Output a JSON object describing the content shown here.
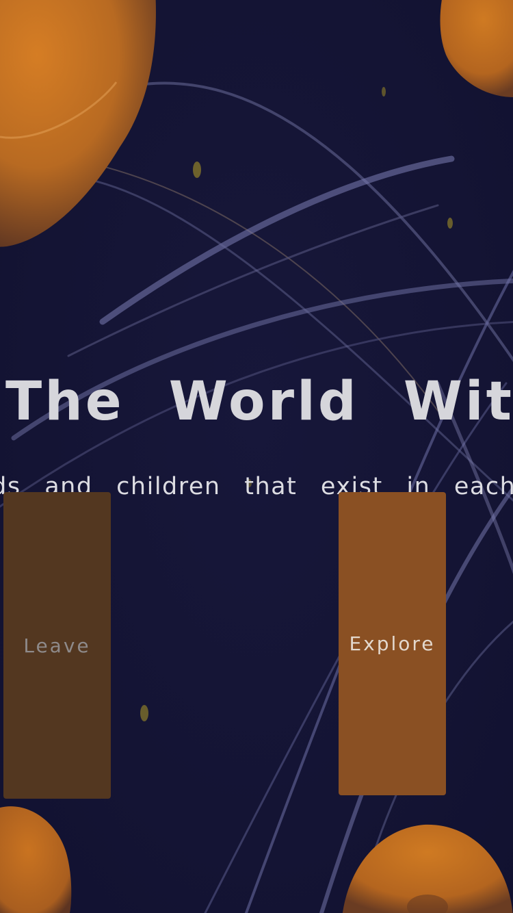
{
  "scene": {
    "title": "The World Within",
    "subtitle": "rlds and children that exist in each"
  },
  "buttons": {
    "leave_label": "Leave",
    "explore_label": "Explore"
  },
  "colors": {
    "background": "#141434",
    "planet_orange": "#c46f1e",
    "leave_button": "#533720",
    "explore_button": "#8a5023",
    "title_text": "#d6d6db"
  }
}
